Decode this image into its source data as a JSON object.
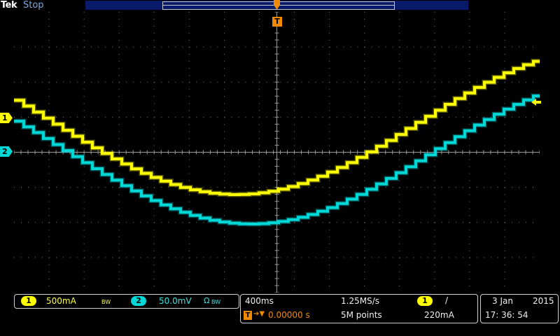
{
  "header": {
    "brand": "Tek",
    "run_state": "Stop"
  },
  "trigger": {
    "marker_label": "T"
  },
  "channels": [
    {
      "id": "1",
      "color": "#ffff00"
    },
    {
      "id": "2",
      "color": "#00d8d8"
    }
  ],
  "readout": {
    "ch1_scale": "500mA",
    "ch1_bw": "BW",
    "ch2_scale": "50.0mV",
    "ch2_flags": "Ω",
    "ch2_bw": "BW",
    "timebase": "400ms",
    "sample_rate": "1.25MS/s",
    "record_length": "5M points",
    "trigger_position": "0.00000 s",
    "trigger_source": "1",
    "trigger_slope_symbol": "/",
    "trigger_level": "220mA",
    "date": "3 Jan",
    "year": "2015",
    "time": "17: 36: 54"
  },
  "colors": {
    "ch1": "#ffff00",
    "ch2": "#00d8d8",
    "trigger": "#f08a00",
    "graticule": "#7a7a7a"
  }
}
